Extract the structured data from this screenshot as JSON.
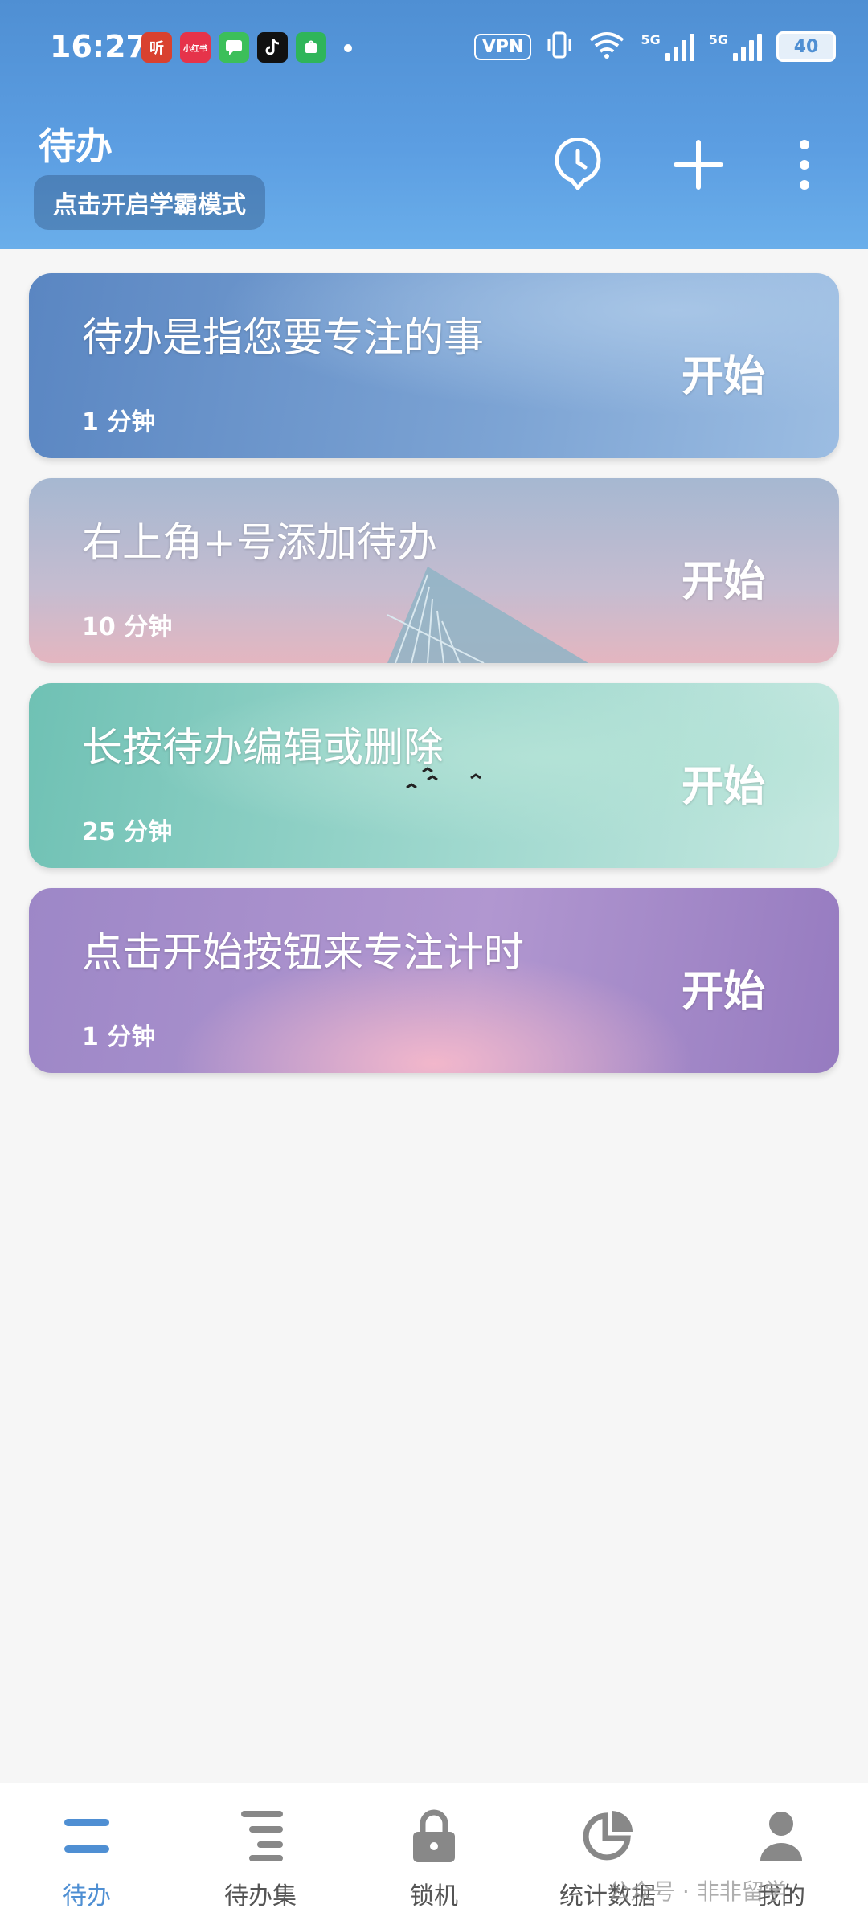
{
  "status_bar": {
    "time": "16:27",
    "vpn": "VPN",
    "signal_label": "5G",
    "battery": "40",
    "notif_icons": [
      "听",
      "小红书",
      "",
      "",
      ""
    ]
  },
  "header": {
    "title": "待办",
    "mode_button": "点击开启学霸模式"
  },
  "tasks": [
    {
      "label": "待办是指您要专注的事",
      "duration": "1 分钟",
      "action": "开始"
    },
    {
      "label": "右上角+号添加待办",
      "duration": "10 分钟",
      "action": "开始"
    },
    {
      "label": "长按待办编辑或删除",
      "duration": "25 分钟",
      "action": "开始"
    },
    {
      "label": "点击开始按钮来专注计时",
      "duration": "1 分钟",
      "action": "开始"
    }
  ],
  "nav": {
    "items": [
      {
        "label": "待办",
        "icon": "todo-icon"
      },
      {
        "label": "待办集",
        "icon": "todo-set-icon"
      },
      {
        "label": "锁机",
        "icon": "lock-icon"
      },
      {
        "label": "统计数据",
        "icon": "stats-icon"
      },
      {
        "label": "我的",
        "icon": "profile-icon"
      }
    ],
    "active": 0
  },
  "watermark": "公众号 · 非非留学",
  "colors": {
    "accent": "#4f8fd3",
    "header": "#5c9ee2"
  }
}
